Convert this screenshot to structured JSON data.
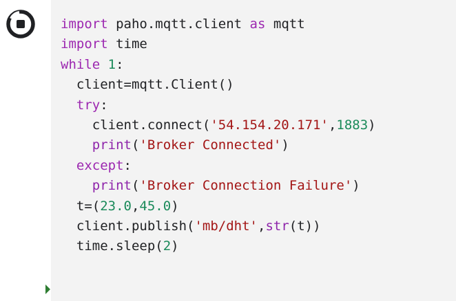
{
  "colors": {
    "keyword": "#9c27b0",
    "number": "#1b8a5a",
    "string": "#a31515",
    "function": "#795e26",
    "default": "#202124",
    "editor_background": "#f3f3f3",
    "run_button": "#202124",
    "current_line_marker": "#2e7d32"
  },
  "icons": {
    "run_button": "run-cell-icon",
    "current_line_marker": "execution-marker-icon"
  },
  "code": {
    "lines": [
      [
        {
          "t": "import",
          "c": "kw"
        },
        {
          "t": " paho.mqtt.client ",
          "c": "plain"
        },
        {
          "t": "as",
          "c": "kw"
        },
        {
          "t": " mqtt",
          "c": "plain"
        }
      ],
      [
        {
          "t": "import",
          "c": "kw"
        },
        {
          "t": " time",
          "c": "plain"
        }
      ],
      [
        {
          "t": "while",
          "c": "kw"
        },
        {
          "t": " ",
          "c": "plain"
        },
        {
          "t": "1",
          "c": "num"
        },
        {
          "t": ":",
          "c": "plain"
        }
      ],
      [
        {
          "t": "  client=mqtt.Client()",
          "c": "plain"
        }
      ],
      [
        {
          "t": "  ",
          "c": "plain"
        },
        {
          "t": "try",
          "c": "kw"
        },
        {
          "t": ":",
          "c": "plain"
        }
      ],
      [
        {
          "t": "    client.connect(",
          "c": "plain"
        },
        {
          "t": "'54.154.20.171'",
          "c": "str"
        },
        {
          "t": ",",
          "c": "plain"
        },
        {
          "t": "1883",
          "c": "num"
        },
        {
          "t": ")",
          "c": "plain"
        }
      ],
      [
        {
          "t": "    ",
          "c": "plain"
        },
        {
          "t": "print",
          "c": "builtin"
        },
        {
          "t": "(",
          "c": "plain"
        },
        {
          "t": "'Broker Connected'",
          "c": "str"
        },
        {
          "t": ")",
          "c": "plain"
        }
      ],
      [
        {
          "t": "  ",
          "c": "plain"
        },
        {
          "t": "except",
          "c": "kw"
        },
        {
          "t": ":",
          "c": "plain"
        }
      ],
      [
        {
          "t": "    ",
          "c": "plain"
        },
        {
          "t": "print",
          "c": "builtin"
        },
        {
          "t": "(",
          "c": "plain"
        },
        {
          "t": "'Broker Connection Failure'",
          "c": "str"
        },
        {
          "t": ")",
          "c": "plain"
        }
      ],
      [
        {
          "t": "  t=(",
          "c": "plain"
        },
        {
          "t": "23.0",
          "c": "num"
        },
        {
          "t": ",",
          "c": "plain"
        },
        {
          "t": "45.0",
          "c": "num"
        },
        {
          "t": ")",
          "c": "plain"
        }
      ],
      [
        {
          "t": "  client.publish(",
          "c": "plain"
        },
        {
          "t": "'mb/dht'",
          "c": "str"
        },
        {
          "t": ",",
          "c": "plain"
        },
        {
          "t": "str",
          "c": "builtin"
        },
        {
          "t": "(t))",
          "c": "plain"
        }
      ],
      [
        {
          "t": "  time.sleep(",
          "c": "plain"
        },
        {
          "t": "2",
          "c": "num"
        },
        {
          "t": ")",
          "c": "plain"
        }
      ]
    ]
  }
}
